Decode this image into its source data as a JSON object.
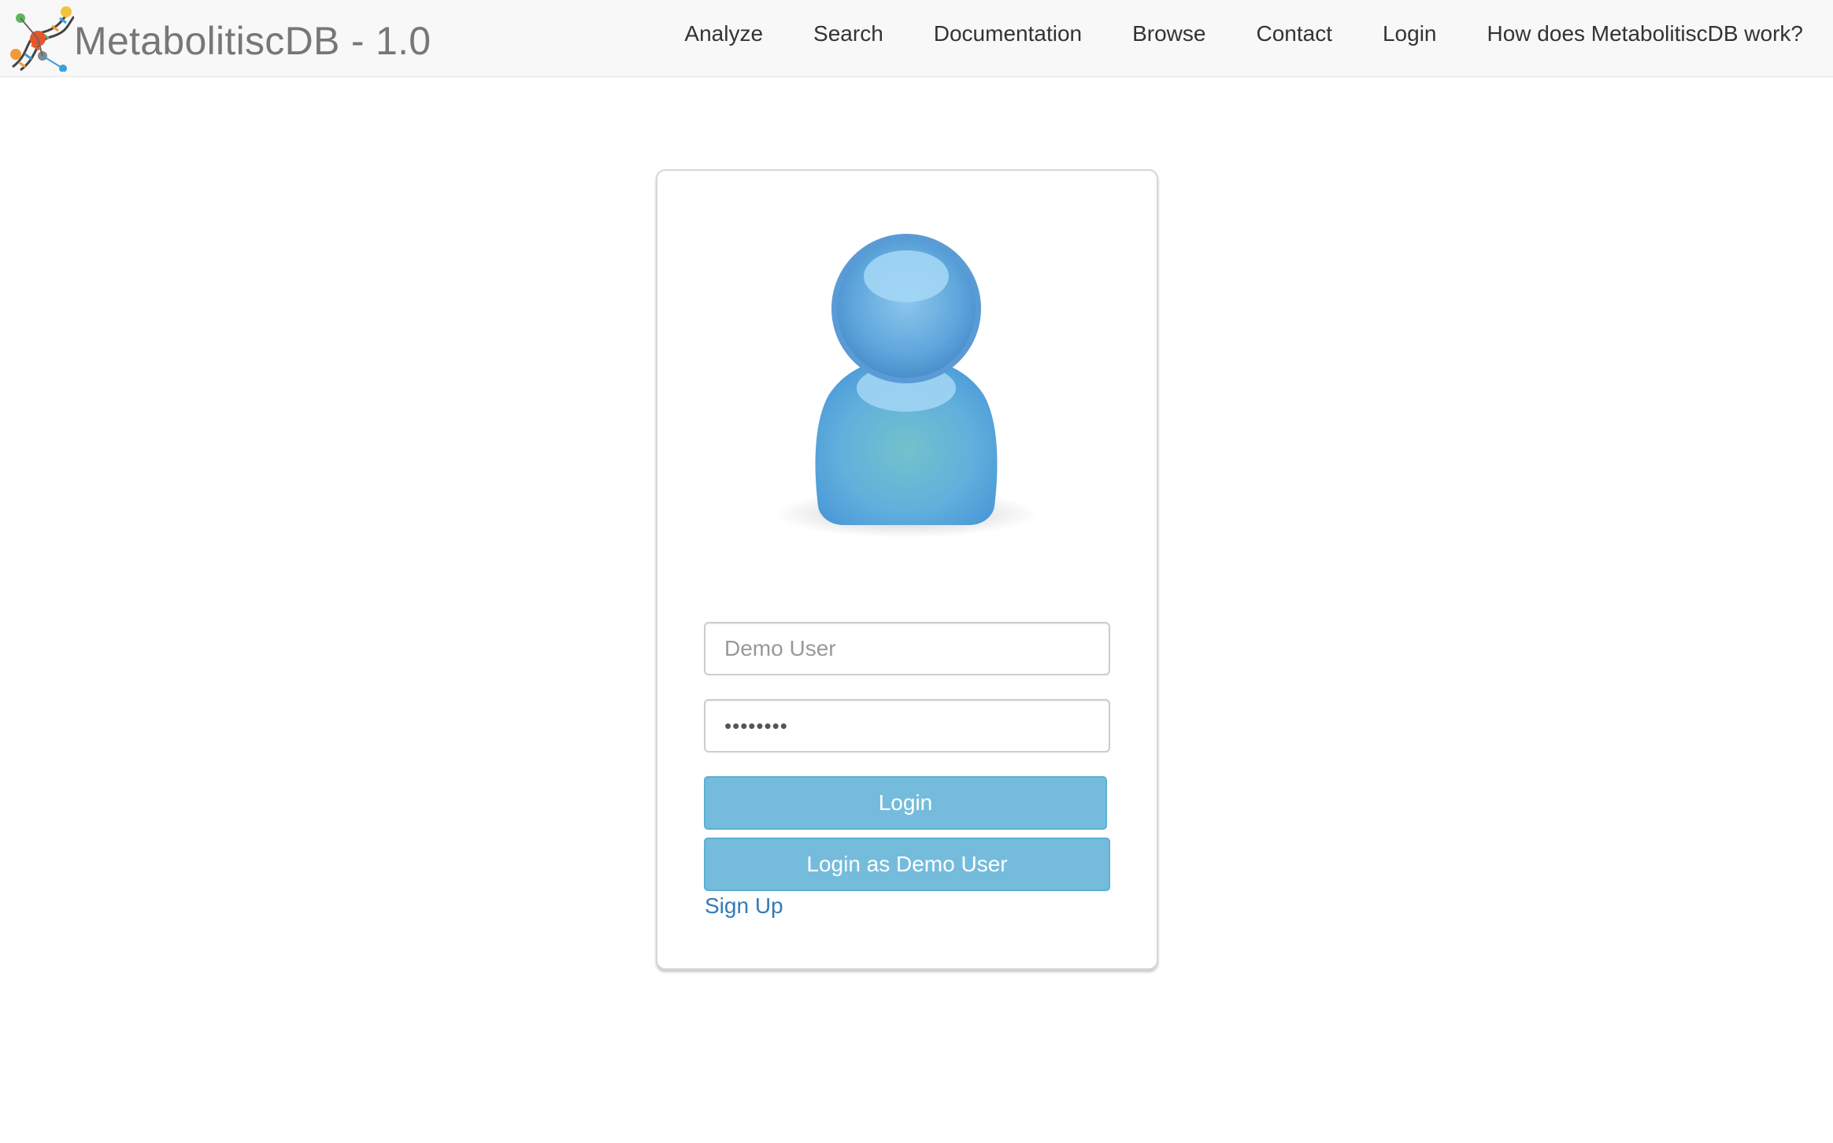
{
  "brand": {
    "title": "MetabolitiscDB - 1.0",
    "logo_icon": "dna-helix-logo-icon"
  },
  "nav": {
    "items": [
      {
        "label": "Analyze"
      },
      {
        "label": "Search"
      },
      {
        "label": "Documentation"
      },
      {
        "label": "Browse"
      },
      {
        "label": "Contact"
      },
      {
        "label": "Login"
      },
      {
        "label": "How does MetabolitiscDB work?"
      }
    ]
  },
  "login": {
    "avatar_icon": "user-avatar-icon",
    "username": {
      "placeholder": "Demo User",
      "value": ""
    },
    "password": {
      "value": "••••••••"
    },
    "login_label": "Login",
    "demo_label": "Login as Demo User",
    "signup_label": "Sign Up"
  },
  "colors": {
    "navbar_bg": "#f8f8f8",
    "button_bg": "#75bcdc",
    "link": "#337ab7",
    "avatar_blue": "#5aa6dc"
  }
}
